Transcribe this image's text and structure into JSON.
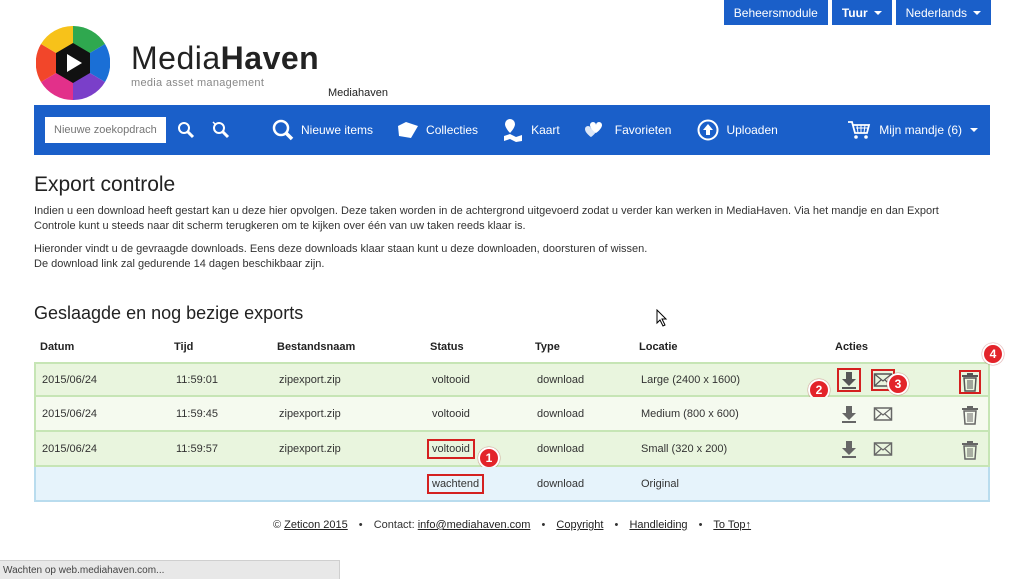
{
  "top_buttons": {
    "admin": "Beheersmodule",
    "tour": "Tuur",
    "language": "Nederlands"
  },
  "logo": {
    "title_plain": "Media",
    "title_bold": "Haven",
    "subtitle": "media asset management",
    "instance": "Mediahaven"
  },
  "nav": {
    "search_placeholder": "Nieuwe zoekopdracht",
    "items": [
      {
        "label": "Nieuwe items",
        "icon": "magnifier-icon"
      },
      {
        "label": "Collecties",
        "icon": "folder-icon"
      },
      {
        "label": "Kaart",
        "icon": "map-pin-icon"
      },
      {
        "label": "Favorieten",
        "icon": "hearts-icon"
      },
      {
        "label": "Uploaden",
        "icon": "upload-arrow-icon"
      }
    ],
    "cart": "Mijn mandje (6)"
  },
  "page": {
    "title": "Export controle",
    "intro1": "Indien u een download heeft gestart kan u deze hier opvolgen. Deze taken worden in de achtergrond uitgevoerd zodat u verder kan werken in MediaHaven. Via het mandje en dan Export Controle kunt u steeds naar dit scherm terugkeren om te kijken over één van uw taken reeds klaar is.",
    "intro2": "Hieronder vindt u de gevraagde downloads. Eens deze downloads klaar staan kunt u deze downloaden, doorsturen of wissen.",
    "intro3": "De download link zal gedurende 14 dagen beschikbaar zijn.",
    "section_title": "Geslaagde en nog bezige exports"
  },
  "table": {
    "headers": {
      "date": "Datum",
      "time": "Tijd",
      "filename": "Bestandsnaam",
      "status": "Status",
      "type": "Type",
      "location": "Locatie",
      "actions": "Acties"
    },
    "rows": [
      {
        "date": "2015/06/24",
        "time": "11:59:01",
        "filename": "zipexport.zip",
        "status": "voltooid",
        "type": "download",
        "location": "Large (2400 x 1600)"
      },
      {
        "date": "2015/06/24",
        "time": "11:59:45",
        "filename": "zipexport.zip",
        "status": "voltooid",
        "type": "download",
        "location": "Medium (800 x 600)"
      },
      {
        "date": "2015/06/24",
        "time": "11:59:57",
        "filename": "zipexport.zip",
        "status": "voltooid",
        "type": "download",
        "location": "Small (320 x 200)"
      },
      {
        "date": "",
        "time": "",
        "filename": "",
        "status": "wachtend",
        "type": "download",
        "location": "Original"
      }
    ]
  },
  "annotations": {
    "b1": "1",
    "b2": "2",
    "b3": "3",
    "b4": "4"
  },
  "footer": {
    "copyright_symbol": "©",
    "company": "Zeticon 2015",
    "contact_label": "Contact:",
    "email": "info@mediahaven.com",
    "copyright": "Copyright",
    "manual": "Handleiding",
    "to_top": "To Top↑"
  },
  "statusbar": "Wachten op web.mediahaven.com...",
  "colors": {
    "brand_blue": "#1a5fc9",
    "row_green": "#e9f5de",
    "row_blue": "#e6f3fb",
    "badge_red": "#e3232a"
  }
}
